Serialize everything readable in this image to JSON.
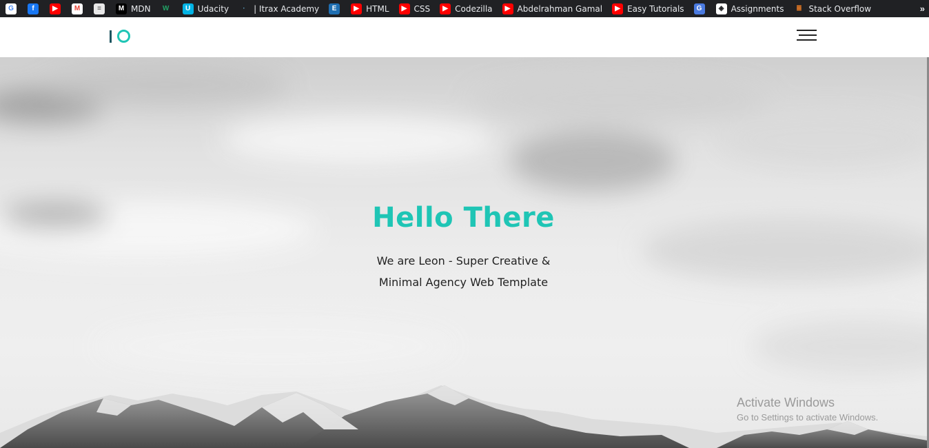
{
  "bookmarks": [
    {
      "label": "",
      "icon": "google-icon",
      "color": "#ffffff",
      "glyph": "G",
      "fg": "#4285f4"
    },
    {
      "label": "",
      "icon": "facebook-icon",
      "color": "#1877f2",
      "glyph": "f",
      "fg": "#ffffff"
    },
    {
      "label": "",
      "icon": "youtube-icon",
      "color": "#ff0000",
      "glyph": "▶",
      "fg": "#ffffff"
    },
    {
      "label": "",
      "icon": "gmail-icon",
      "color": "#ffffff",
      "glyph": "M",
      "fg": "#ea4335"
    },
    {
      "label": "",
      "icon": "site-icon",
      "color": "#e8e8e8",
      "glyph": "≡",
      "fg": "#555555"
    },
    {
      "label": "MDN",
      "icon": "mdn-icon",
      "color": "#000000",
      "glyph": "M",
      "fg": "#ffffff"
    },
    {
      "label": "",
      "icon": "w-icon",
      "color": "#202124",
      "glyph": "W",
      "fg": "#21a366"
    },
    {
      "label": "Udacity",
      "icon": "udacity-icon",
      "color": "#02b3e4",
      "glyph": "U",
      "fg": "#ffffff"
    },
    {
      "label": "| Itrax Academy",
      "icon": "itrax-icon",
      "color": "#202124",
      "glyph": "·",
      "fg": "#5aa0c0"
    },
    {
      "label": "",
      "icon": "e-icon",
      "color": "#1f6fb2",
      "glyph": "E",
      "fg": "#ffffff"
    },
    {
      "label": "HTML",
      "icon": "youtube-icon",
      "color": "#ff0000",
      "glyph": "▶",
      "fg": "#ffffff"
    },
    {
      "label": "CSS",
      "icon": "youtube-icon",
      "color": "#ff0000",
      "glyph": "▶",
      "fg": "#ffffff"
    },
    {
      "label": "Codezilla",
      "icon": "youtube-icon",
      "color": "#ff0000",
      "glyph": "▶",
      "fg": "#ffffff"
    },
    {
      "label": "Abdelrahman Gamal",
      "icon": "youtube-icon",
      "color": "#ff0000",
      "glyph": "▶",
      "fg": "#ffffff"
    },
    {
      "label": "Easy Tutorials",
      "icon": "youtube-icon",
      "color": "#ff0000",
      "glyph": "▶",
      "fg": "#ffffff"
    },
    {
      "label": "",
      "icon": "translate-icon",
      "color": "#4a7ae0",
      "glyph": "G",
      "fg": "#ffffff"
    },
    {
      "label": "Assignments",
      "icon": "assignments-icon",
      "color": "#ffffff",
      "glyph": "◈",
      "fg": "#202124"
    },
    {
      "label": "Stack Overflow",
      "icon": "stackoverflow-icon",
      "color": "#202124",
      "glyph": "≣",
      "fg": "#f48024"
    }
  ],
  "bookmarks_more": "»",
  "header": {
    "logo_colors": {
      "bar": "#1d5560",
      "ring": "#1fc5b5"
    }
  },
  "hero": {
    "title": "Hello There",
    "subtitle_line1": "We are Leon - Super Creative &",
    "subtitle_line2": "Minimal Agency Web Template",
    "accent": "#1fc5b5"
  },
  "watermark": {
    "line1": "Activate Windows",
    "line2": "Go to Settings to activate Windows."
  }
}
